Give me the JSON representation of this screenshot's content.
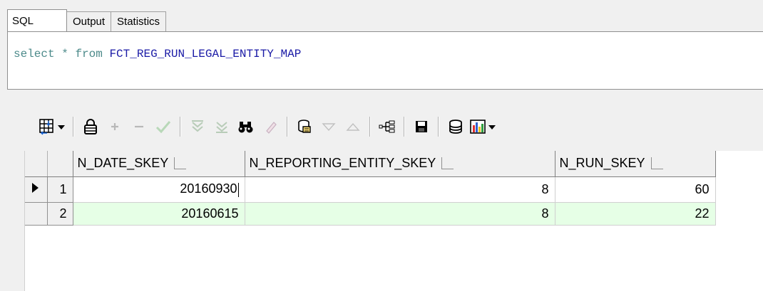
{
  "tabs": [
    {
      "label": "SQL",
      "active": true
    },
    {
      "label": "Output",
      "active": false
    },
    {
      "label": "Statistics",
      "active": false
    }
  ],
  "editor": {
    "keyword_select": "select",
    "star": "*",
    "keyword_from": "from",
    "table_name": "FCT_REG_RUN_LEGAL_ENTITY_MAP"
  },
  "toolbar_icons": [
    "grid-layout-icon",
    "dropdown-arrow-icon",
    "lock-icon",
    "insert-record-icon",
    "delete-record-icon",
    "post-edit-icon",
    "filter-icon",
    "clear-filter-icon",
    "find-icon",
    "clear-icon",
    "query-by-example-icon",
    "next-icon",
    "previous-icon",
    "explain-plan-icon",
    "save-icon",
    "export-icon",
    "chart-icon",
    "chart-dropdown-icon"
  ],
  "grid": {
    "columns": [
      "N_DATE_SKEY",
      "N_REPORTING_ENTITY_SKEY",
      "N_RUN_SKEY"
    ],
    "rows": [
      {
        "num": "1",
        "values": [
          "20160930",
          "8",
          "60"
        ],
        "current": true
      },
      {
        "num": "2",
        "values": [
          "20160615",
          "8",
          "22"
        ],
        "current": false
      }
    ]
  },
  "colors": {
    "alt_row": "#e6ffe6",
    "sql_keyword": "#4c8a8a",
    "sql_identifier": "#1a1aa6"
  }
}
